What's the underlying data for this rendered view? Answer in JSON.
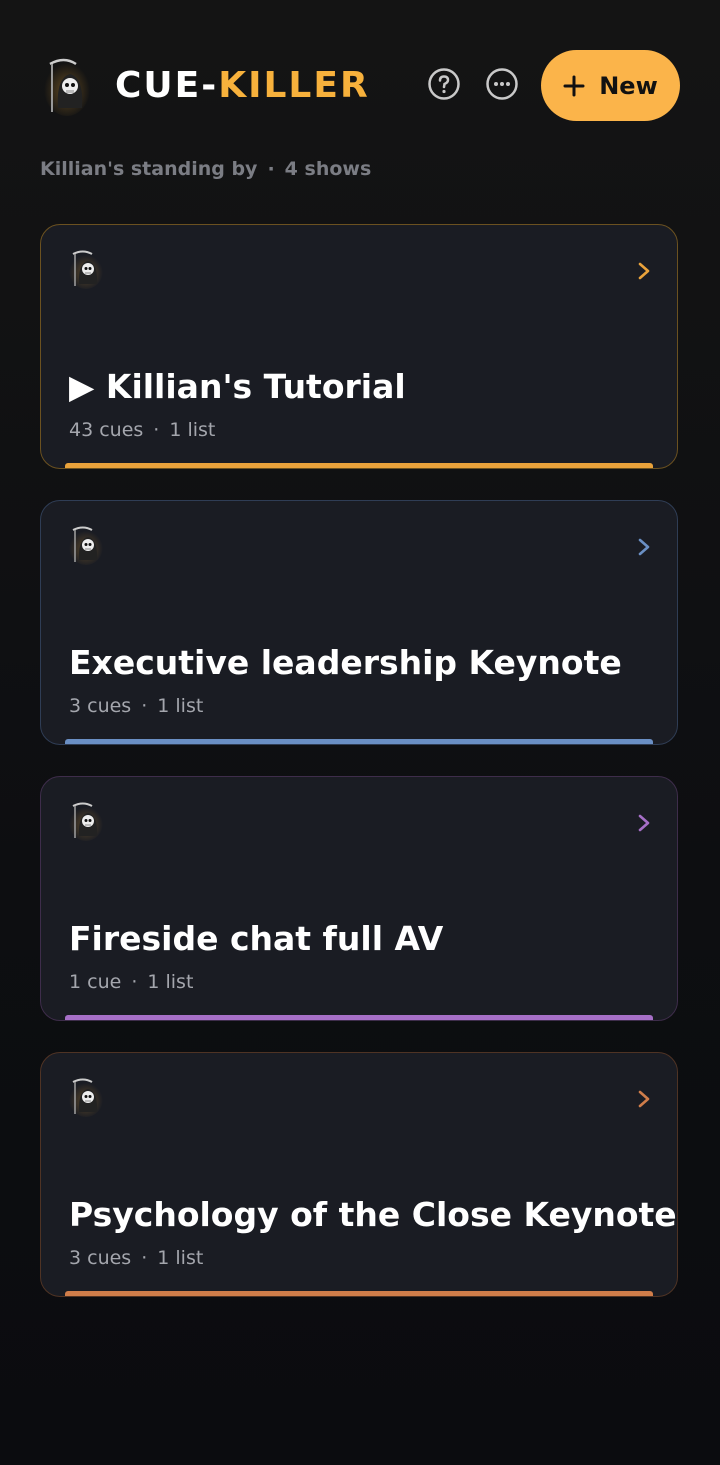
{
  "header": {
    "brand_part1": "CUE-",
    "brand_part2": "KILLER",
    "new_button_label": "New"
  },
  "subtitle": {
    "status": "Killian's standing by",
    "separator": "·",
    "count": "4 shows"
  },
  "colors": {
    "accent": "#f7b13c",
    "background": "#0d0e11",
    "card_bg": "#1a1c23"
  },
  "shows": [
    {
      "title": "▶ Killian's Tutorial",
      "cues": "43 cues",
      "separator": "·",
      "lists": "1 list",
      "color": "#e9a23b",
      "border": "#6b5120"
    },
    {
      "title": "Executive leadership Keynote",
      "cues": "3 cues",
      "separator": "·",
      "lists": "1 list",
      "color": "#6a8fc4",
      "border": "#2f3d55"
    },
    {
      "title": "Fireside chat full AV",
      "cues": "1 cue",
      "separator": "·",
      "lists": "1 list",
      "color": "#a66fc7",
      "border": "#3e2d4b"
    },
    {
      "title": "Psychology of the Close Keynote",
      "cues": "3 cues",
      "separator": "·",
      "lists": "1 list",
      "color": "#d07d4a",
      "border": "#4f3324"
    }
  ]
}
